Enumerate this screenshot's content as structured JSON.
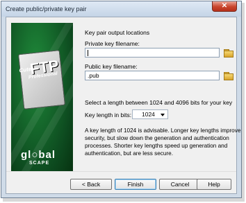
{
  "window": {
    "title": "Create public/private key pair",
    "close_glyph": "✕"
  },
  "branding": {
    "cute": "Cute",
    "ftp": "FTP",
    "professional": "Professional",
    "global": "gl○bal",
    "scape": "SCAPE"
  },
  "form": {
    "section_heading": "Key pair output locations",
    "private_label": "Private key filename:",
    "private_value": "",
    "public_label": "Public key filename:",
    "public_value": ".pub",
    "length_instruction": "Select a length between 1024 and 4096 bits for your key",
    "length_label": "Key length in bits:",
    "length_value": "1024",
    "description": [
      "A key length of 1024 is advisable. Longer key lengths improve",
      "security, but slow down the generation and authentication",
      "processes.  Shorter key lengths speed up generation and",
      "authentication, but are less secure."
    ]
  },
  "buttons": {
    "back": "< Back",
    "finish": "Finish",
    "cancel": "Cancel",
    "help": "Help"
  },
  "icons": {
    "browse": "folder-open-icon",
    "dropdown": "chevron-down-icon",
    "close": "close-icon"
  }
}
